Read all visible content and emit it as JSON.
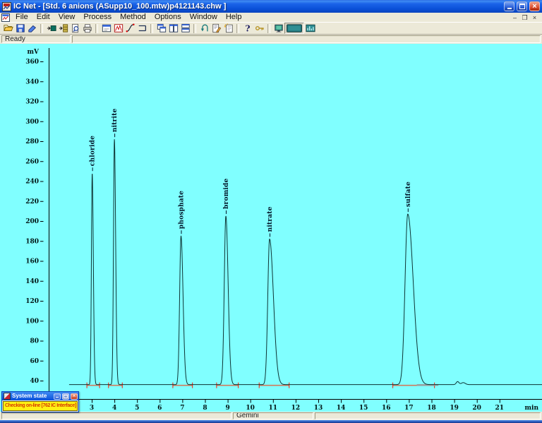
{
  "window": {
    "title": "IC Net - [Std. 6 anions (ASupp10_100.mtw)p4121143.chw ]",
    "controls": [
      "minimize",
      "restore",
      "close"
    ],
    "mdi_controls": [
      "minimize",
      "restore",
      "close"
    ]
  },
  "menu": {
    "items": [
      "File",
      "Edit",
      "View",
      "Process",
      "Method",
      "Options",
      "Window",
      "Help"
    ]
  },
  "toolbar": {
    "groups": [
      [
        "open",
        "save",
        "eraser"
      ],
      [
        "connect",
        "archive",
        "print-preview",
        "print"
      ],
      [
        "window-properties",
        "recorder",
        "integration",
        "baseline"
      ],
      [
        "cascade-windows",
        "tile-vertical",
        "tile-horizontal"
      ],
      [
        "reprocess",
        "edit-report",
        "new-window"
      ],
      [
        "help",
        "key"
      ],
      [
        "system-monitor",
        "display-active",
        "chart-display"
      ]
    ],
    "active_button": "display-active"
  },
  "ready_bar": {
    "status": "Ready"
  },
  "status_bar": {
    "panels": [
      "",
      "Gemini",
      ""
    ]
  },
  "system_state": {
    "title": "System state",
    "message": "Checking on-line [762 IC Interface]"
  },
  "chart_data": {
    "type": "line",
    "title": "",
    "xlabel": "min",
    "ylabel": "mV",
    "xlim": [
      2.0,
      22.9
    ],
    "ylim": [
      28,
      372
    ],
    "x_ticks": [
      3,
      4,
      5,
      6,
      7,
      8,
      9,
      10,
      11,
      12,
      13,
      14,
      15,
      16,
      17,
      18,
      19,
      20,
      21
    ],
    "y_ticks": [
      40,
      60,
      80,
      100,
      120,
      140,
      160,
      180,
      200,
      220,
      240,
      260,
      280,
      300,
      320,
      340,
      360
    ],
    "grid": false,
    "legend": false,
    "baseline_mV": 36,
    "peaks": [
      {
        "label": "chloride",
        "rt_min": 3.02,
        "apex_mV": 248,
        "sigma_left_min": 0.035,
        "sigma_right_min": 0.05
      },
      {
        "label": "nitrite",
        "rt_min": 4.0,
        "apex_mV": 282,
        "sigma_left_min": 0.04,
        "sigma_right_min": 0.055
      },
      {
        "label": "phosphate",
        "rt_min": 6.94,
        "apex_mV": 185,
        "sigma_left_min": 0.06,
        "sigma_right_min": 0.09
      },
      {
        "label": "bromide",
        "rt_min": 8.92,
        "apex_mV": 205,
        "sigma_left_min": 0.07,
        "sigma_right_min": 0.1
      },
      {
        "label": "nitrate",
        "rt_min": 10.85,
        "apex_mV": 182,
        "sigma_left_min": 0.08,
        "sigma_right_min": 0.17
      },
      {
        "label": "sulfate",
        "rt_min": 16.95,
        "apex_mV": 207,
        "sigma_left_min": 0.12,
        "sigma_right_min": 0.24
      }
    ],
    "minor_features": [
      {
        "t": 19.15,
        "amp_mV": 3,
        "sigma": 0.06
      },
      {
        "t": 19.4,
        "amp_mV": 2,
        "sigma": 0.09
      }
    ],
    "baseline_marks": {
      "gray_segment_min": [
        17.35,
        18.3
      ]
    }
  },
  "colors": {
    "chart_bg": "#80FFFF",
    "curve": "#0E3434",
    "integration_mark": "#FF1A00",
    "integration_baseline": "#CF7A5C",
    "gray_segment": "#98A0A0",
    "titlebar_blue": "#0A50D8",
    "state_bg": "#FFF114",
    "state_text": "#D83C00"
  }
}
